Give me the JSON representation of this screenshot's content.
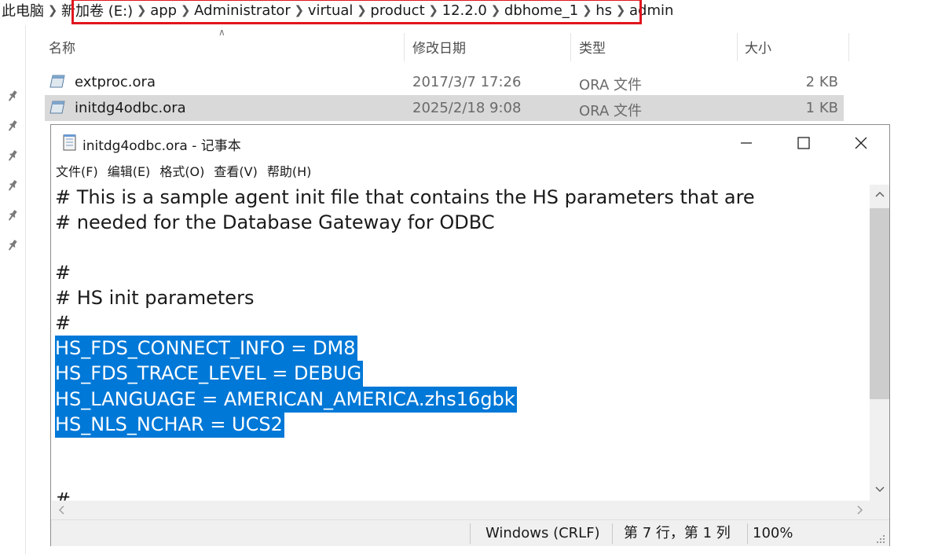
{
  "breadcrumb": {
    "items": [
      "此电脑",
      "新加卷 (E:)",
      "app",
      "Administrator",
      "virtual",
      "product",
      "12.2.0",
      "dbhome_1",
      "hs",
      "admin"
    ]
  },
  "file_list": {
    "columns": {
      "name": "名称",
      "date": "修改日期",
      "type": "类型",
      "size": "大小"
    },
    "rows": [
      {
        "name": "extproc.ora",
        "date": "2017/3/7 17:26",
        "type": "ORA 文件",
        "size": "2 KB",
        "selected": false
      },
      {
        "name": "initdg4odbc.ora",
        "date": "2025/2/18 9:08",
        "type": "ORA 文件",
        "size": "1 KB",
        "selected": true
      }
    ]
  },
  "notepad": {
    "title": "initdg4odbc.ora - 记事本",
    "menu": [
      "文件(F)",
      "编辑(E)",
      "格式(O)",
      "查看(V)",
      "帮助(H)"
    ],
    "lines": [
      {
        "text": "# This is a sample agent init file that contains the HS parameters that are",
        "selected": false
      },
      {
        "text": "# needed for the Database Gateway for ODBC",
        "selected": false
      },
      {
        "text": "",
        "selected": false
      },
      {
        "text": "#",
        "selected": false
      },
      {
        "text": "# HS init parameters",
        "selected": false
      },
      {
        "text": "#",
        "selected": false
      },
      {
        "text": "HS_FDS_CONNECT_INFO = DM8",
        "selected": true
      },
      {
        "text": "HS_FDS_TRACE_LEVEL = DEBUG",
        "selected": true
      },
      {
        "text": "HS_LANGUAGE = AMERICAN_AMERICA.zhs16gbk",
        "selected": true
      },
      {
        "text": "HS_NLS_NCHAR = UCS2",
        "selected": true
      },
      {
        "text": "",
        "selected": false
      },
      {
        "text": "",
        "selected": false
      },
      {
        "text": "#",
        "selected": false
      }
    ],
    "status": {
      "line_ending": "Windows (CRLF)",
      "position": "第 7 行，第 1 列",
      "zoom": "100%"
    }
  },
  "colors": {
    "selection": "#0078d7",
    "breadcrumb_highlight": "#e0161e",
    "row_selected": "#d9d9d9"
  }
}
